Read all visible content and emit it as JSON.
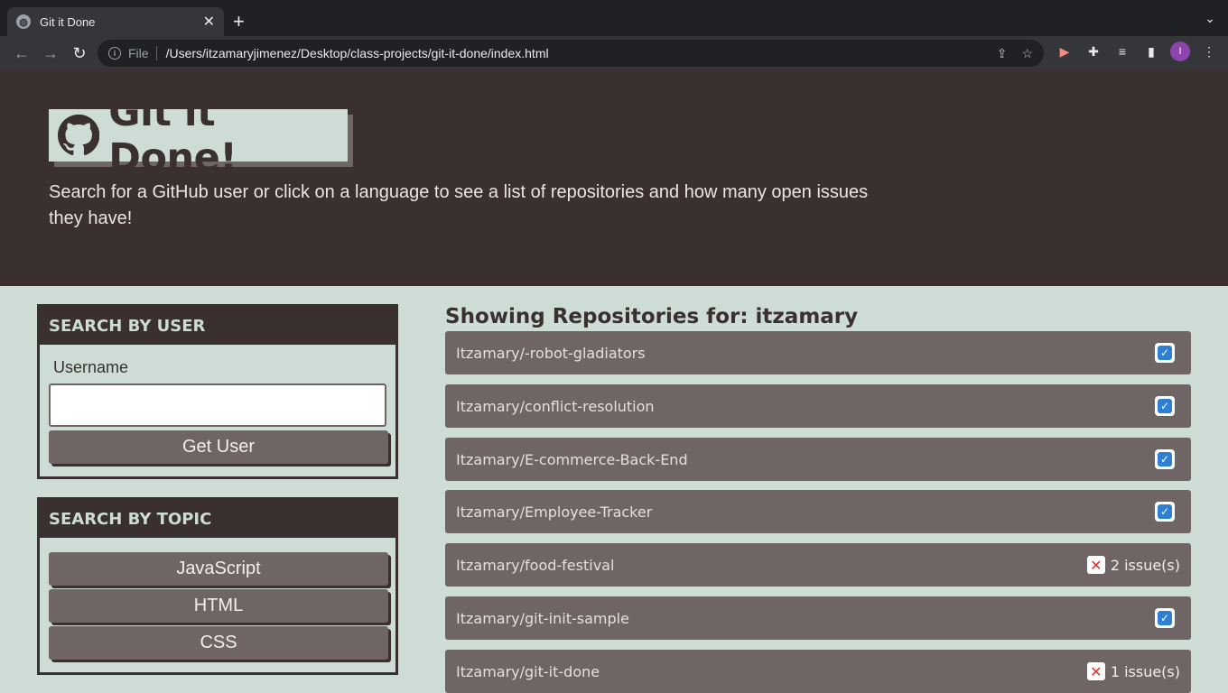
{
  "browser": {
    "tab_title": "Git it Done",
    "new_tab": "+",
    "scheme_label": "File",
    "url": "/Users/itzamaryjimenez/Desktop/class-projects/git-it-done/index.html",
    "profile_initial": "I"
  },
  "header": {
    "title": "Git it Done!",
    "subtitle": "Search for a GitHub user or click on a language to see a list of repositories and how many open issues they have!"
  },
  "user_search": {
    "heading": "SEARCH BY USER",
    "label": "Username",
    "value": "",
    "button": "Get User"
  },
  "topic_search": {
    "heading": "SEARCH BY TOPIC",
    "topics": [
      "JavaScript",
      "HTML",
      "CSS"
    ]
  },
  "repos": {
    "title": "Showing Repositories for: itzamary",
    "items": [
      {
        "name": "Itzamary/-robot-gladiators",
        "status": "ok",
        "issues": ""
      },
      {
        "name": "Itzamary/conflict-resolution",
        "status": "ok",
        "issues": ""
      },
      {
        "name": "Itzamary/E-commerce-Back-End",
        "status": "ok",
        "issues": ""
      },
      {
        "name": "Itzamary/Employee-Tracker",
        "status": "ok",
        "issues": ""
      },
      {
        "name": "Itzamary/food-festival",
        "status": "issues",
        "issues": "2 issue(s)"
      },
      {
        "name": "Itzamary/git-init-sample",
        "status": "ok",
        "issues": ""
      },
      {
        "name": "Itzamary/git-it-done",
        "status": "issues",
        "issues": "1 issue(s)"
      }
    ]
  }
}
